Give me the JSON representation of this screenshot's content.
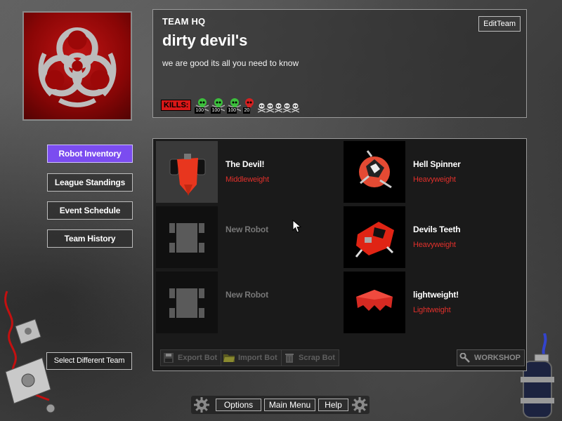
{
  "hq": {
    "label": "TEAM HQ",
    "team_name": "dirty devil's",
    "motto": "we are good its all you need to know",
    "edit_button": "EditTeam",
    "kills_label": "KILLS:",
    "kill_badges": [
      "100",
      "100",
      "100",
      "20"
    ]
  },
  "nav": {
    "robot_inventory": "Robot Inventory",
    "league_standings": "League Standings",
    "event_schedule": "Event Schedule",
    "team_history": "Team History",
    "select_team": "Select Different Team"
  },
  "robots": [
    {
      "name": "The Devil!",
      "class": "Middleweight"
    },
    {
      "name": "Hell Spinner",
      "class": "Heavyweight"
    },
    {
      "name": "New Robot",
      "class": ""
    },
    {
      "name": "Devils Teeth",
      "class": "Heavyweight"
    },
    {
      "name": "New Robot",
      "class": ""
    },
    {
      "name": "lightweight!",
      "class": "Lightweight"
    }
  ],
  "tools": {
    "export": "Export Bot",
    "import": "Import Bot",
    "scrap": "Scrap Bot",
    "workshop": "WORKSHOP"
  },
  "bottom": {
    "options": "Options",
    "main_menu": "Main Menu",
    "help": "Help"
  },
  "colors": {
    "accent": "#7b4cf0",
    "class_text": "#e0302b",
    "kills_red": "#d81818"
  },
  "icons": [
    "biohazard-icon",
    "skull-icon",
    "floppy-icon",
    "folder-icon",
    "trash-icon",
    "wrench-icon",
    "gear-icon",
    "cursor-icon"
  ]
}
